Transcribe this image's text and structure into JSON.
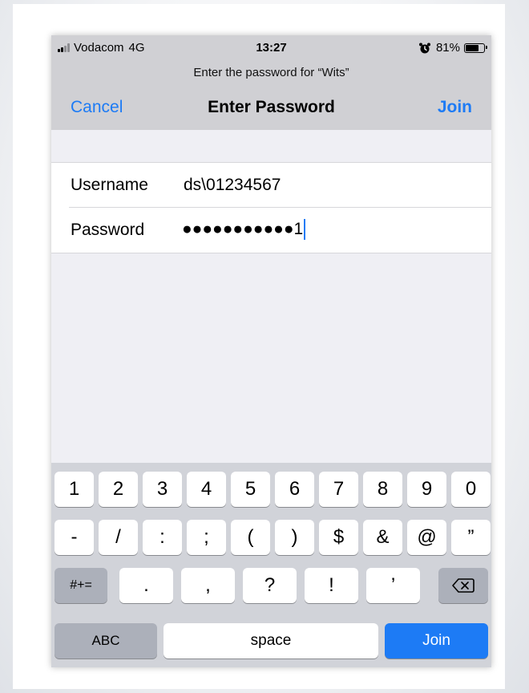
{
  "status_bar": {
    "carrier": "Vodacom",
    "network": "4G",
    "time": "13:27",
    "battery": "81%",
    "battery_level": 0.81,
    "signal_bars_filled": 2,
    "signal_bars_total": 4,
    "icons": [
      "signal-icon",
      "alarm-icon",
      "battery-icon"
    ]
  },
  "header": {
    "prompt": "Enter the password for “Wits”",
    "title": "Enter Password",
    "cancel_label": "Cancel",
    "join_label": "Join"
  },
  "form": {
    "username_label": "Username",
    "username_value": "ds\\01234567",
    "password_label": "Password",
    "password_value": "●●●●●●●●●●●1"
  },
  "keyboard": {
    "row1": [
      "1",
      "2",
      "3",
      "4",
      "5",
      "6",
      "7",
      "8",
      "9",
      "0"
    ],
    "row2": [
      "-",
      "/",
      ":",
      ";",
      "(",
      ")",
      "$",
      "&",
      "@",
      "”"
    ],
    "row3_shift_label": "#+=",
    "row3": [
      ".",
      ",",
      "?",
      "!",
      "’"
    ],
    "abc_label": "ABC",
    "space_label": "space",
    "join_label": "Join",
    "delete_icon": "backspace-icon"
  },
  "colors": {
    "accent": "#1d7bf5",
    "nav_background": "#d0d0d4",
    "keyboard_background": "#d1d3d9"
  }
}
